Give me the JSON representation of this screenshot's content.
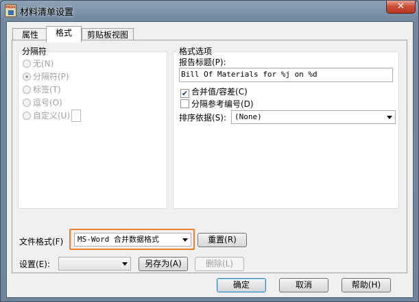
{
  "window": {
    "title": "材料清单设置",
    "app_icon_text": "PADS",
    "close_symbol": "✕"
  },
  "tabs": [
    {
      "label": "属性"
    },
    {
      "label": "格式"
    },
    {
      "label": "剪贴板视图"
    }
  ],
  "separator_group": {
    "title": "分隔符",
    "options": [
      {
        "label": "无(N)",
        "checked": false
      },
      {
        "label": "分隔符(P)",
        "checked": true
      },
      {
        "label": "标签(T)",
        "checked": false
      },
      {
        "label": "逗号(O)",
        "checked": false
      },
      {
        "label": "自定义(U)",
        "checked": false
      }
    ]
  },
  "format_options": {
    "title": "格式选项",
    "report_title_label": "报告标题(P):",
    "report_title_value": "Bill Of Materials for %j on %d",
    "merge_values_label": "合并值/容差(C)",
    "merge_values_checked": true,
    "split_refdes_label": "分隔参考编号(D)",
    "split_refdes_checked": false,
    "sort_by_label": "排序依据(S):",
    "sort_by_value": "(None)"
  },
  "file_format": {
    "label": "文件格式(F)",
    "value": "MS-Word 合并数据格式",
    "reset_label": "重置(R)",
    "highlight_color": "#ee7d28"
  },
  "settings": {
    "label": "设置(E):",
    "value": "",
    "save_as_label": "另存为(A)",
    "delete_label": "删除(L)"
  },
  "footer": {
    "ok_label": "确定",
    "cancel_label": "取消",
    "help_label": "帮助(H)"
  }
}
